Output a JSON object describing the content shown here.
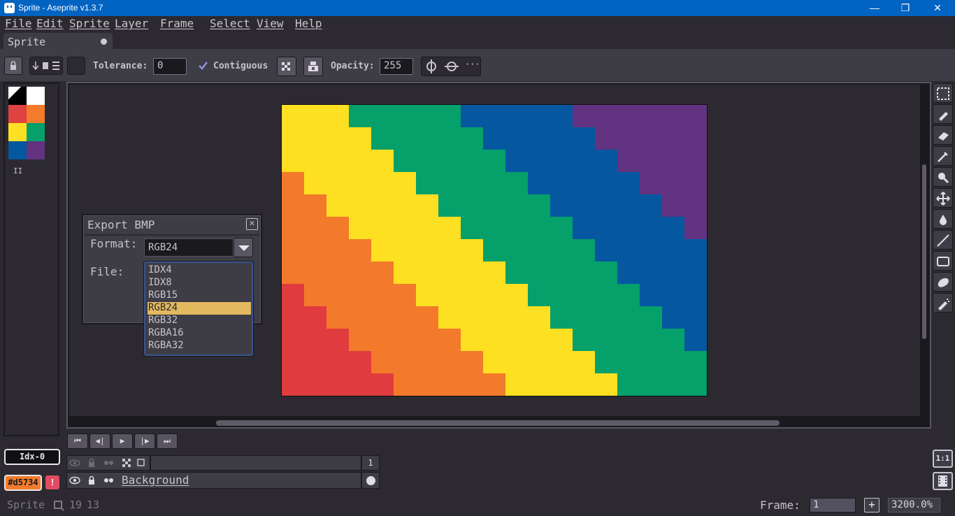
{
  "window": {
    "title": "Sprite - Aseprite v1.3.7",
    "minimize": "—",
    "maximize": "❐",
    "close": "✕"
  },
  "menu": [
    "File",
    "Edit",
    "Sprite",
    "Layer",
    "Frame",
    "Select",
    "View",
    "Help"
  ],
  "tab": {
    "label": "Sprite"
  },
  "context_bar": {
    "tolerance_label": "Tolerance:",
    "tolerance_value": "0",
    "contiguous_label": "Contiguous",
    "contiguous_checked": true,
    "opacity_label": "Opacity:",
    "opacity_value": "255",
    "more": "···"
  },
  "palette": {
    "colors": [
      "#000000",
      "#ffffff",
      "#e04141",
      "#f37b2b",
      "#fde021",
      "#06a06b",
      "#0458a0",
      "#633381"
    ],
    "handle": "II"
  },
  "sprite": {
    "stripe_colors": [
      "#e03b3e",
      "#f37a2b",
      "#fde021",
      "#06a06b",
      "#0557a0",
      "#623380"
    ]
  },
  "export_dialog": {
    "title": "Export BMP",
    "format_label": "Format:",
    "format_value": "RGB24",
    "file_label": "File:",
    "options": [
      "IDX4",
      "IDX8",
      "RGB15",
      "RGB24",
      "RGB32",
      "RGBA16",
      "RGBA32"
    ],
    "selected_index": 3
  },
  "playback": [
    "⏮",
    "◀|",
    "▶",
    "|▶",
    "⏭"
  ],
  "timeline": {
    "frame_number": "1",
    "layer_name": "Background"
  },
  "color_bar": {
    "index_label": "Idx-0",
    "fg_hex": "#d5734",
    "warning": "!"
  },
  "right_buttons": {
    "one_to_one": "1:1"
  },
  "status": {
    "sprite_name": "Sprite",
    "width": "19",
    "height": "13",
    "frame_label": "Frame:",
    "frame_value": "1",
    "add_frame": "+",
    "zoom": "3200.0%"
  }
}
